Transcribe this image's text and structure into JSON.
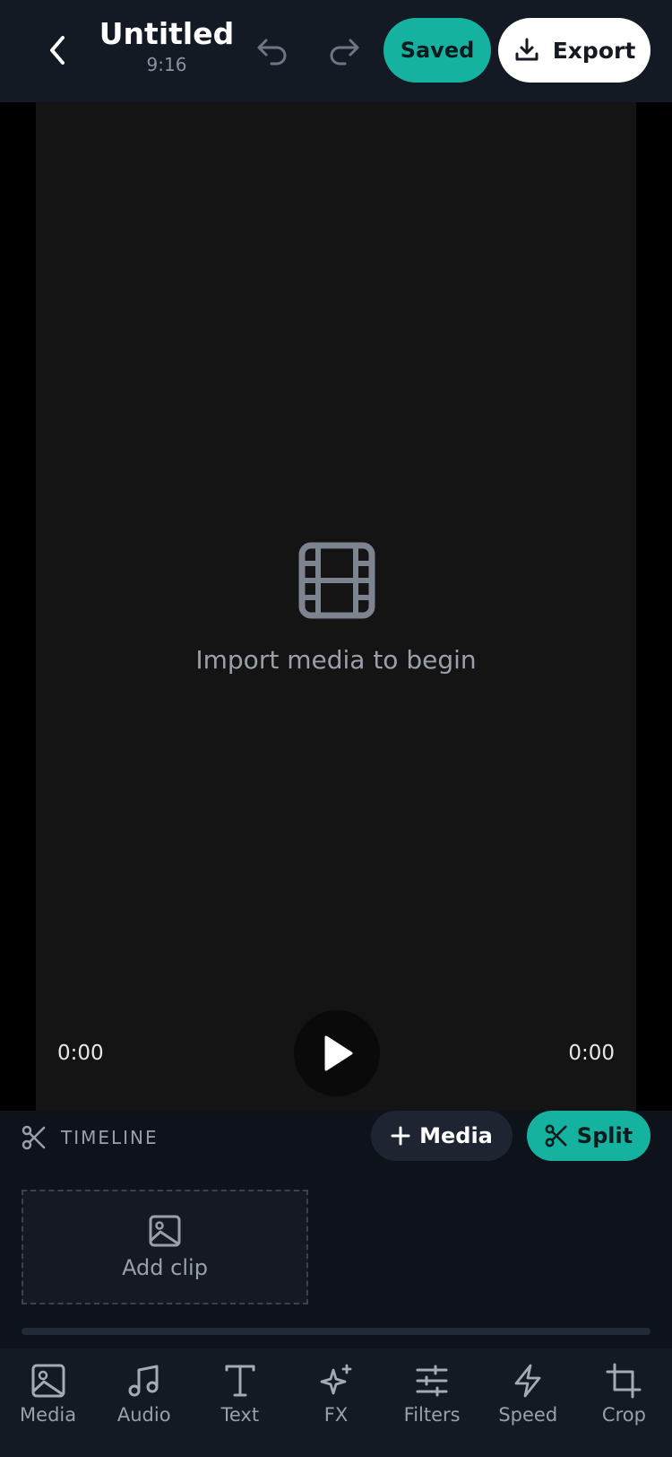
{
  "header": {
    "title": "Untitled",
    "aspect": "9:16",
    "saved_label": "Saved",
    "export_label": "Export"
  },
  "preview": {
    "empty_message": "Import media to begin",
    "time_current": "0:00",
    "time_total": "0:00"
  },
  "timeline": {
    "label": "TIMELINE",
    "media_button": "Media",
    "split_button": "Split",
    "add_clip_label": "Add clip"
  },
  "toolbar": {
    "items": [
      {
        "label": "Media",
        "icon": "image-icon"
      },
      {
        "label": "Audio",
        "icon": "music-note-icon"
      },
      {
        "label": "Text",
        "icon": "text-icon"
      },
      {
        "label": "FX",
        "icon": "sparkles-icon"
      },
      {
        "label": "Filters",
        "icon": "sliders-icon"
      },
      {
        "label": "Speed",
        "icon": "lightning-icon"
      },
      {
        "label": "Crop",
        "icon": "crop-icon"
      }
    ]
  },
  "colors": {
    "accent": "#16b2a0",
    "header_bg": "#141a24",
    "preview_bg": "#141414"
  }
}
